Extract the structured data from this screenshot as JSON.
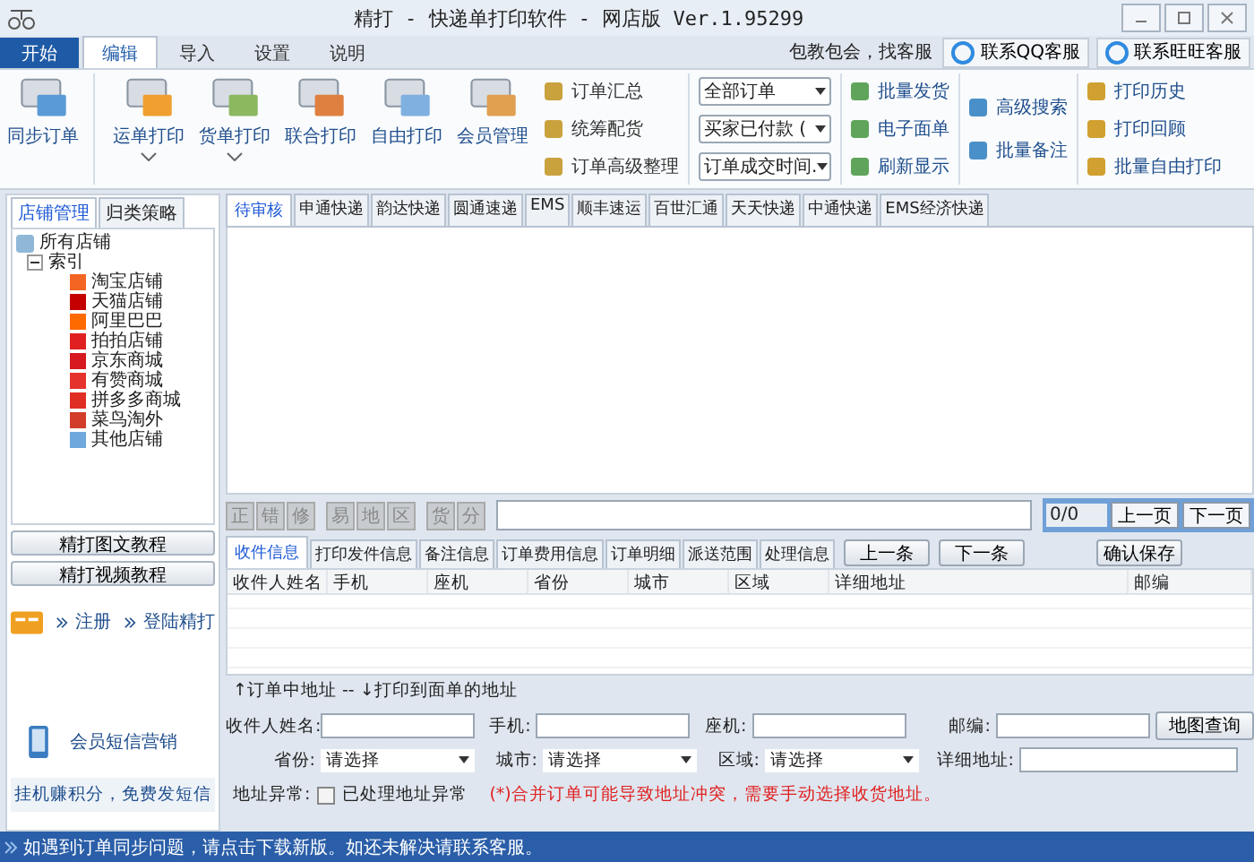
{
  "window": {
    "title": "精打 - 快递单打印软件 - 网店版 Ver.1.95299"
  },
  "menu_tabs": [
    {
      "label": "开始",
      "kind": "start",
      "selected": false
    },
    {
      "label": "编辑",
      "kind": "tab",
      "selected": true
    },
    {
      "label": "导入",
      "kind": "tab",
      "selected": false
    },
    {
      "label": "设置",
      "kind": "tab",
      "selected": false
    },
    {
      "label": "说明",
      "kind": "tab",
      "selected": false
    }
  ],
  "support": {
    "text": "包教包会，找客服",
    "buttons": [
      "联系QQ客服",
      "联系旺旺客服"
    ]
  },
  "ribbon": {
    "large_buttons": [
      {
        "label": "同步订单",
        "kind": "sync",
        "dropdown": false
      },
      {
        "label": "运单打印",
        "kind": "truck",
        "dropdown": true
      },
      {
        "label": "货单打印",
        "kind": "sheet",
        "dropdown": true
      },
      {
        "label": "联合打印",
        "kind": "combo",
        "dropdown": false
      },
      {
        "label": "自由打印",
        "kind": "mail",
        "dropdown": false
      },
      {
        "label": "会员管理",
        "kind": "people",
        "dropdown": false
      }
    ],
    "order_tools": [
      "订单汇总",
      "统筹配货",
      "订单高级整理"
    ],
    "filters": [
      "全部订单",
      "买家已付款 (",
      "订单成交时间."
    ],
    "ship_tools": [
      "批量发货",
      "电子面单",
      "刷新显示"
    ],
    "search_tools": [
      "高级搜索",
      "批量备注"
    ],
    "history_tools": [
      "打印历史",
      "打印回顾",
      "批量自由打印"
    ]
  },
  "sidebar": {
    "tabs": [
      {
        "label": "店铺管理",
        "selected": true
      },
      {
        "label": "归类策略",
        "selected": false
      }
    ],
    "tree": {
      "label": "所有店铺",
      "children": [
        {
          "label": "索引",
          "expanded": true,
          "children": [
            {
              "label": "淘宝店铺",
              "color": "#f26522"
            },
            {
              "label": "天猫店铺",
              "color": "#c40000"
            },
            {
              "label": "阿里巴巴",
              "color": "#ff6a00"
            },
            {
              "label": "拍拍店铺",
              "color": "#e02020"
            },
            {
              "label": "京东商城",
              "color": "#d71920"
            },
            {
              "label": "有赞商城",
              "color": "#e5322d"
            },
            {
              "label": "拼多多商城",
              "color": "#e02e24"
            },
            {
              "label": "菜鸟淘外",
              "color": "#d23c2a"
            },
            {
              "label": "其他店铺",
              "color": "#6fa8dc"
            }
          ]
        }
      ]
    },
    "tutorial_buttons": [
      "精打图文教程",
      "精打视频教程"
    ],
    "links": [
      "注册",
      "登陆精打"
    ],
    "sms": "会员短信营销",
    "promo": "挂机赚积分，免费发短信"
  },
  "courier_tabs": [
    {
      "label": "待审核",
      "selected": true
    },
    {
      "label": "申通快递",
      "selected": false
    },
    {
      "label": "韵达快递",
      "selected": false
    },
    {
      "label": "圆通速递",
      "selected": false
    },
    {
      "label": "EMS",
      "selected": false
    },
    {
      "label": "顺丰速运",
      "selected": false
    },
    {
      "label": "百世汇通",
      "selected": false
    },
    {
      "label": "天天快递",
      "selected": false
    },
    {
      "label": "中通快递",
      "selected": false
    },
    {
      "label": "EMS经济快递",
      "selected": false
    }
  ],
  "toolbar": {
    "char_buttons": [
      [
        "正",
        "错",
        "修"
      ],
      [
        "易",
        "地",
        "区"
      ],
      [
        "货",
        "分"
      ]
    ],
    "page": "0/0",
    "prev_page": "上一页",
    "next_page": "下一页"
  },
  "detail_tabs": [
    {
      "label": "收件信息",
      "selected": true
    },
    {
      "label": "打印发件信息",
      "selected": false
    },
    {
      "label": "备注信息",
      "selected": false
    },
    {
      "label": "订单费用信息",
      "selected": false
    },
    {
      "label": "订单明细",
      "selected": false
    },
    {
      "label": "派送范围",
      "selected": false
    },
    {
      "label": "处理信息",
      "selected": false
    }
  ],
  "nav_buttons": [
    "上一条",
    "下一条"
  ],
  "save_button": "确认保存",
  "table": {
    "columns": [
      "收件人姓名",
      "手机",
      "座机",
      "省份",
      "城市",
      "区域",
      "详细地址",
      "邮编"
    ]
  },
  "address_note": "↑订单中地址 -- ↓打印到面单的地址",
  "form": {
    "name_label": "收件人姓名:",
    "mobile_label": "手机:",
    "phone_label": "座机:",
    "zip_label": "邮编:",
    "map_button": "地图查询",
    "selects": [
      {
        "label": "省份:",
        "value": "请选择"
      },
      {
        "label": "城市:",
        "value": "请选择"
      },
      {
        "label": "区域:",
        "value": "请选择"
      }
    ],
    "address_label": "详细地址:",
    "abnormal_label": "地址异常:",
    "abnormal_check": {
      "label": "已处理地址异常",
      "checked": false
    },
    "warning": "(*)合并订单可能导致地址冲突，需要手动选择收货地址。"
  },
  "status_bar": "如遇到订单同步问题，请点击下载新版。如还未解决请联系客服。"
}
